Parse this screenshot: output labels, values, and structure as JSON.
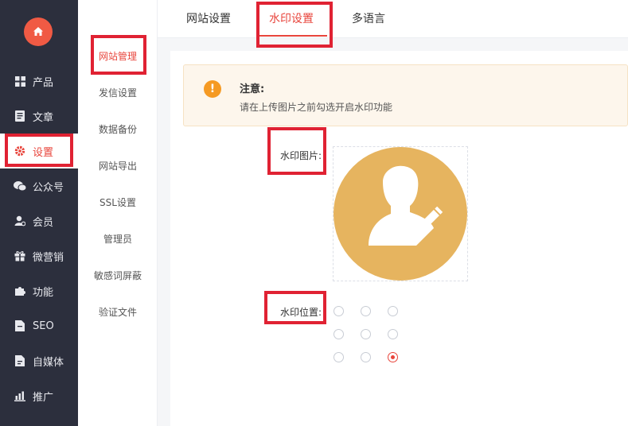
{
  "sidebar": {
    "items": [
      {
        "label": "产品",
        "icon": "grid-icon"
      },
      {
        "label": "文章",
        "icon": "document-icon"
      },
      {
        "label": "设置",
        "icon": "gear-icon",
        "active": true
      },
      {
        "label": "公众号",
        "icon": "wechat-icon"
      },
      {
        "label": "会员",
        "icon": "user-icon"
      },
      {
        "label": "微营销",
        "icon": "gift-icon"
      },
      {
        "label": "功能",
        "icon": "puzzle-icon"
      },
      {
        "label": "SEO",
        "icon": "seo-file-icon"
      },
      {
        "label": "自媒体",
        "icon": "media-file-icon"
      },
      {
        "label": "推广",
        "icon": "chart-icon"
      }
    ]
  },
  "submenu": {
    "items": [
      "网站管理",
      "发信设置",
      "数据备份",
      "网站导出",
      "SSL设置",
      "管理员",
      "敏感词屏蔽",
      "验证文件"
    ]
  },
  "tabs": [
    "网站设置",
    "水印设置",
    "多语言"
  ],
  "notice": {
    "title": "注意:",
    "text": "请在上传图片之前勾选开启水印功能",
    "icon": "!"
  },
  "form": {
    "image_label": "水印图片:",
    "position_label": "水印位置:",
    "positions_selected": 9
  },
  "colors": {
    "accent": "#e8453c",
    "sidebar_bg": "#2c2f3d",
    "warning": "#f59a23",
    "avatar": "#e6b45f",
    "annotation": "#e02233"
  }
}
